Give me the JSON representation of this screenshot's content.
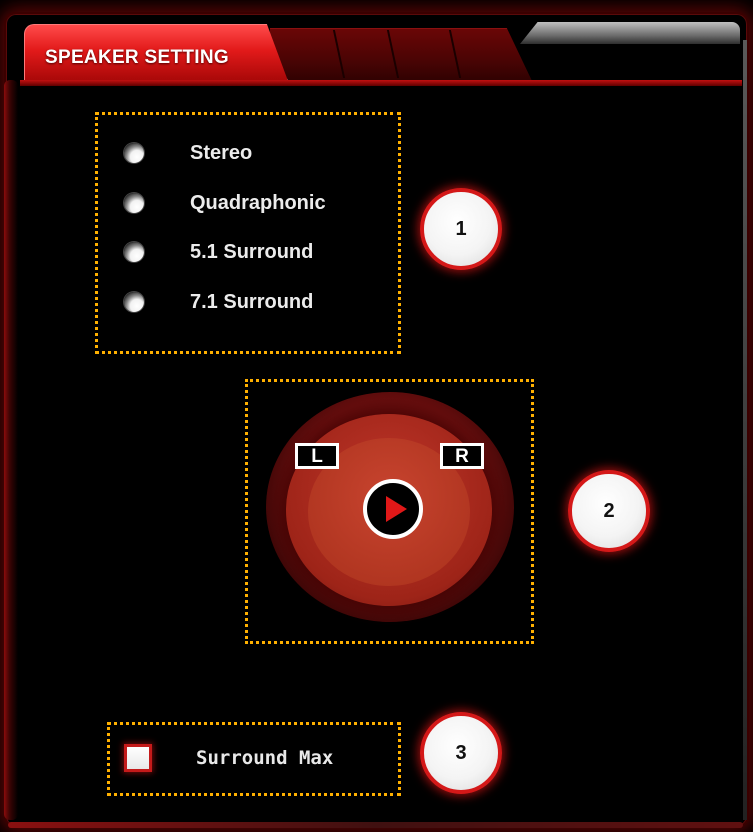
{
  "tabs": [
    {
      "label": "SPEAKER SETTING",
      "active": true
    },
    {
      "label": "",
      "active": false
    },
    {
      "label": "",
      "active": false
    },
    {
      "label": "",
      "active": false
    }
  ],
  "speaker_mode": {
    "options": [
      {
        "label": "Stereo"
      },
      {
        "label": "Quadraphonic"
      },
      {
        "label": "5.1 Surround"
      },
      {
        "label": "7.1 Surround"
      }
    ]
  },
  "speaker_test": {
    "left_label": "L",
    "right_label": "R",
    "play_icon": "play-icon"
  },
  "surround_max": {
    "label": "Surround Max",
    "checked": false
  },
  "callouts": [
    "1",
    "2",
    "3"
  ],
  "colors": {
    "accent_red": "#e21a1a",
    "annotation_border": "#ffb000",
    "background": "#000000",
    "text": "#ececec"
  }
}
